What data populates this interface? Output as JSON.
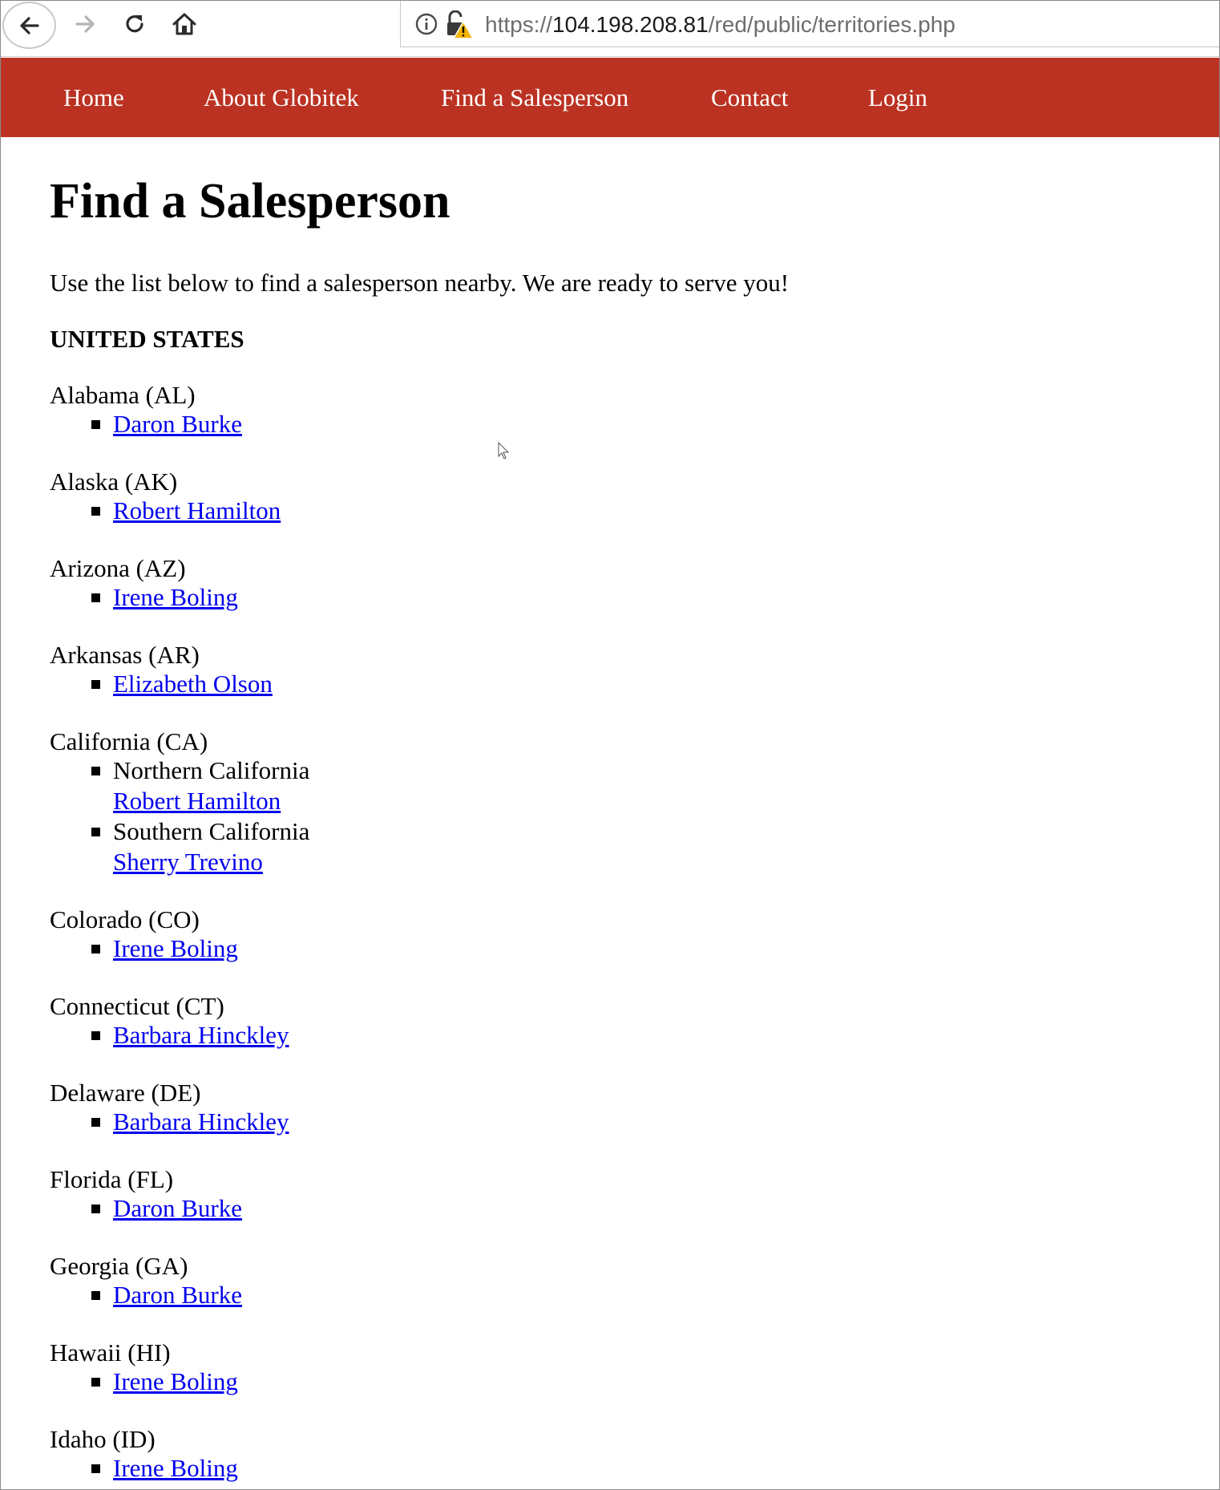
{
  "browser": {
    "url_prefix": "https://",
    "url_host": "104.198.208.81",
    "url_path": "/red/public/territories.php"
  },
  "nav": {
    "items": [
      {
        "label": "Home"
      },
      {
        "label": "About Globitek"
      },
      {
        "label": "Find a Salesperson"
      },
      {
        "label": "Contact"
      },
      {
        "label": "Login"
      }
    ],
    "background_color": "#bb3222"
  },
  "page": {
    "title": "Find a Salesperson",
    "intro": "Use the list below to find a salesperson nearby. We are ready to serve you!",
    "country": "UNITED STATES"
  },
  "states": [
    {
      "name": "Alabama (AL)",
      "salespeople": [
        {
          "name": "Daron Burke"
        }
      ]
    },
    {
      "name": "Alaska (AK)",
      "salespeople": [
        {
          "name": "Robert Hamilton"
        }
      ]
    },
    {
      "name": "Arizona (AZ)",
      "salespeople": [
        {
          "name": "Irene Boling"
        }
      ]
    },
    {
      "name": "Arkansas (AR)",
      "salespeople": [
        {
          "name": "Elizabeth Olson"
        }
      ]
    },
    {
      "name": "California (CA)",
      "salespeople": [
        {
          "region": "Northern California",
          "name": "Robert Hamilton"
        },
        {
          "region": "Southern California",
          "name": "Sherry Trevino"
        }
      ]
    },
    {
      "name": "Colorado (CO)",
      "salespeople": [
        {
          "name": "Irene Boling"
        }
      ]
    },
    {
      "name": "Connecticut (CT)",
      "salespeople": [
        {
          "name": "Barbara Hinckley"
        }
      ]
    },
    {
      "name": "Delaware (DE)",
      "salespeople": [
        {
          "name": "Barbara Hinckley"
        }
      ]
    },
    {
      "name": "Florida (FL)",
      "salespeople": [
        {
          "name": "Daron Burke"
        }
      ]
    },
    {
      "name": "Georgia (GA)",
      "salespeople": [
        {
          "name": "Daron Burke"
        }
      ]
    },
    {
      "name": "Hawaii (HI)",
      "salespeople": [
        {
          "name": "Irene Boling"
        }
      ]
    },
    {
      "name": "Idaho (ID)",
      "salespeople": [
        {
          "name": "Irene Boling"
        }
      ]
    }
  ],
  "colors": {
    "link": "#0000ee",
    "text": "#000000"
  }
}
